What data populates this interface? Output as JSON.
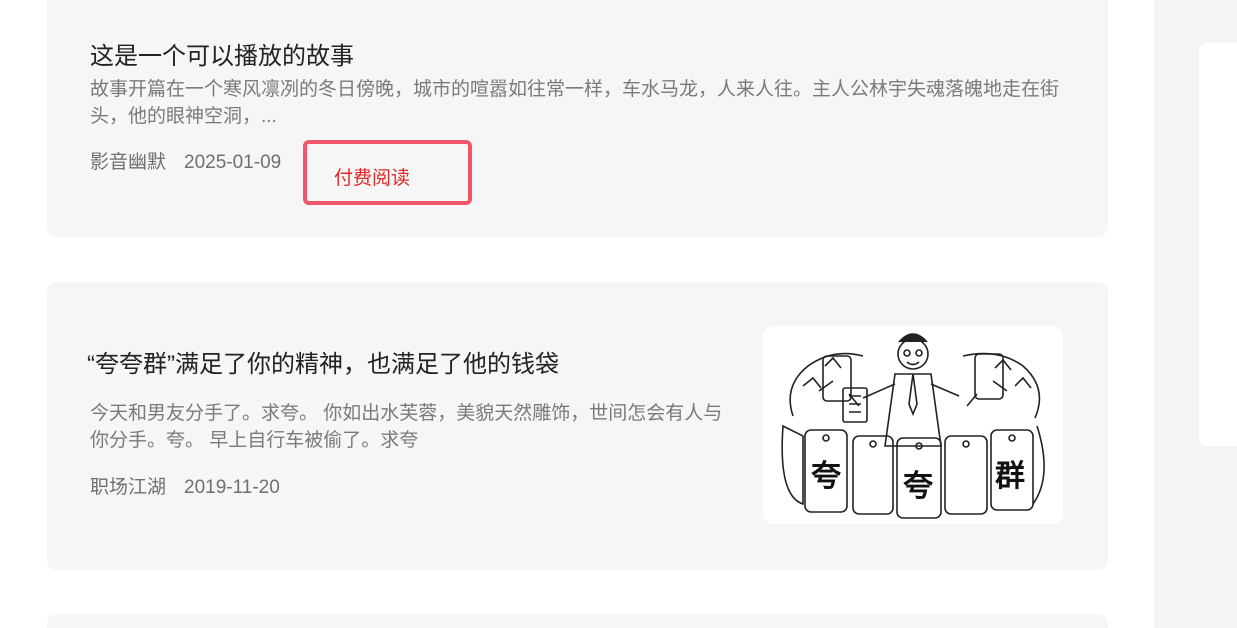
{
  "articles": [
    {
      "title": "这是一个可以播放的故事",
      "summary": "故事开篇在一个寒风凛冽的冬日傍晚，城市的喧嚣如往常一样，车水马龙，人来人往。主人公林宇失魂落魄地走在街头，他的眼神空洞，...",
      "author": "影音幽默",
      "date": "2025-01-09",
      "paid_label": "付费阅读"
    },
    {
      "title": "“夸夸群”满足了你的精神，也满足了他的钱袋",
      "summary": "今天和男友分手了。求夸。 你如出水芙蓉，美貌天然雕饰，世间怎会有人与你分手。夸。 早上自行车被偷了。求夸",
      "author": "职场江湖",
      "date": "2019-11-20",
      "thumbnail": {
        "icon": "cartoon-illustration",
        "panel_text": [
          "夸",
          "夸",
          "群"
        ]
      }
    }
  ]
}
